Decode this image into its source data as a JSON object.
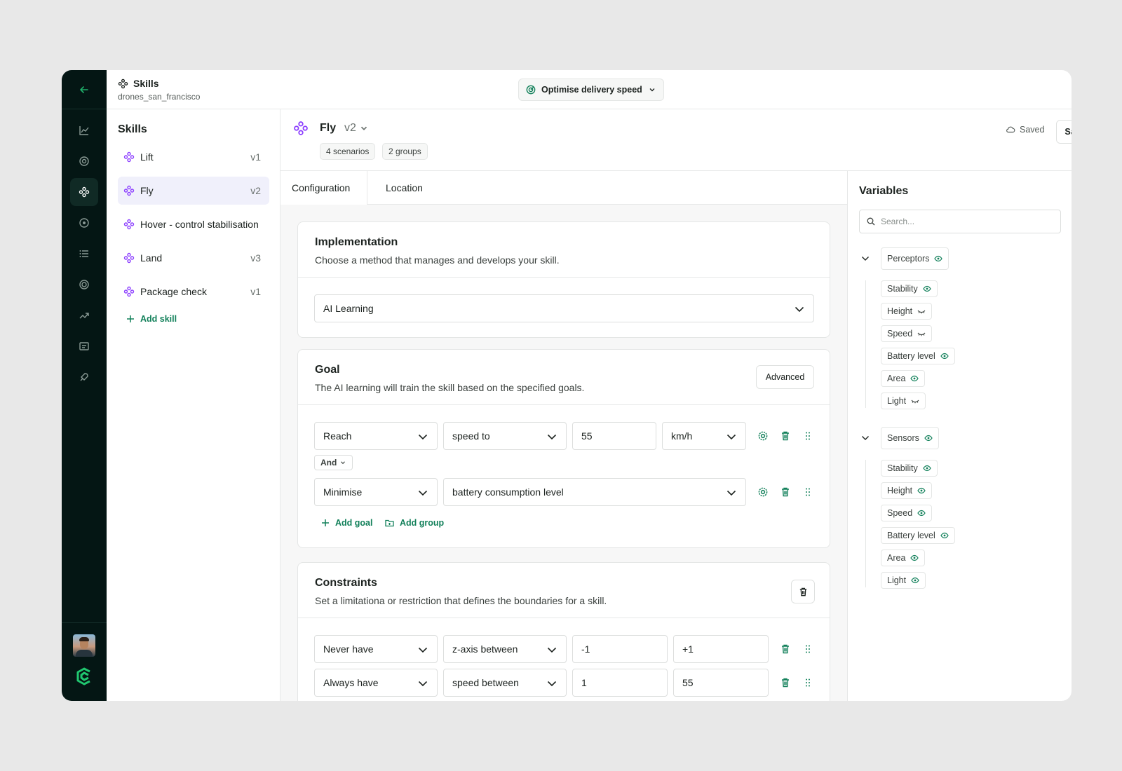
{
  "topbar": {
    "title": "Skills",
    "subtitle": "drones_san_francisco",
    "goal_selector": "Optimise delivery speed"
  },
  "skills_panel": {
    "heading": "Skills",
    "items": [
      {
        "name": "Lift",
        "version": "v1"
      },
      {
        "name": "Fly",
        "version": "v2"
      },
      {
        "name": "Hover - control stabilisation",
        "version": ""
      },
      {
        "name": "Land",
        "version": "v3"
      },
      {
        "name": "Package check",
        "version": "v1"
      }
    ],
    "add_label": "Add skill"
  },
  "skill_header": {
    "name": "Fly",
    "version": "v2",
    "tags": [
      "4 scenarios",
      "2 groups"
    ],
    "saved_label": "Saved",
    "save_button": "Save"
  },
  "tabs": [
    "Configuration",
    "Location"
  ],
  "implementation": {
    "title": "Implementation",
    "description": "Choose a  method that manages and develops your skill.",
    "method": "AI Learning"
  },
  "goal": {
    "title": "Goal",
    "description": "The AI learning will train the skill based on the specified goals.",
    "advanced_button": "Advanced",
    "row1": {
      "action": "Reach",
      "target": "speed to",
      "value": "55",
      "unit": "km/h"
    },
    "connector": "And",
    "row2": {
      "action": "Minimise",
      "target": "battery consumption level"
    },
    "add_goal": "Add goal",
    "add_group": "Add group"
  },
  "constraints": {
    "title": "Constraints",
    "description": "Set a limitationa or restriction that defines the boundaries for a skill.",
    "rows": [
      {
        "mode": "Never have",
        "target": "z-axis between",
        "from": "-1",
        "to": "+1"
      },
      {
        "mode": "Always have",
        "target": "speed between",
        "from": "1",
        "to": "55"
      }
    ]
  },
  "variables": {
    "heading": "Variables",
    "search_placeholder": "Search...",
    "groups": [
      {
        "name": "Perceptors",
        "visible": true,
        "items": [
          {
            "name": "Stability",
            "visible": true
          },
          {
            "name": "Height",
            "visible": false
          },
          {
            "name": "Speed",
            "visible": false
          },
          {
            "name": "Battery level",
            "visible": true
          },
          {
            "name": "Area",
            "visible": true
          },
          {
            "name": "Light",
            "visible": false
          }
        ]
      },
      {
        "name": "Sensors",
        "visible": true,
        "items": [
          {
            "name": "Stability",
            "visible": true
          },
          {
            "name": "Height",
            "visible": true
          },
          {
            "name": "Speed",
            "visible": true
          },
          {
            "name": "Battery level",
            "visible": true
          },
          {
            "name": "Area",
            "visible": true
          },
          {
            "name": "Light",
            "visible": true
          }
        ]
      }
    ]
  },
  "colors": {
    "rail": "#041614",
    "accent_green": "#12805a",
    "skill_icon_purple": "#8b3dff",
    "active_skill_bg": "#f0f0fb"
  }
}
